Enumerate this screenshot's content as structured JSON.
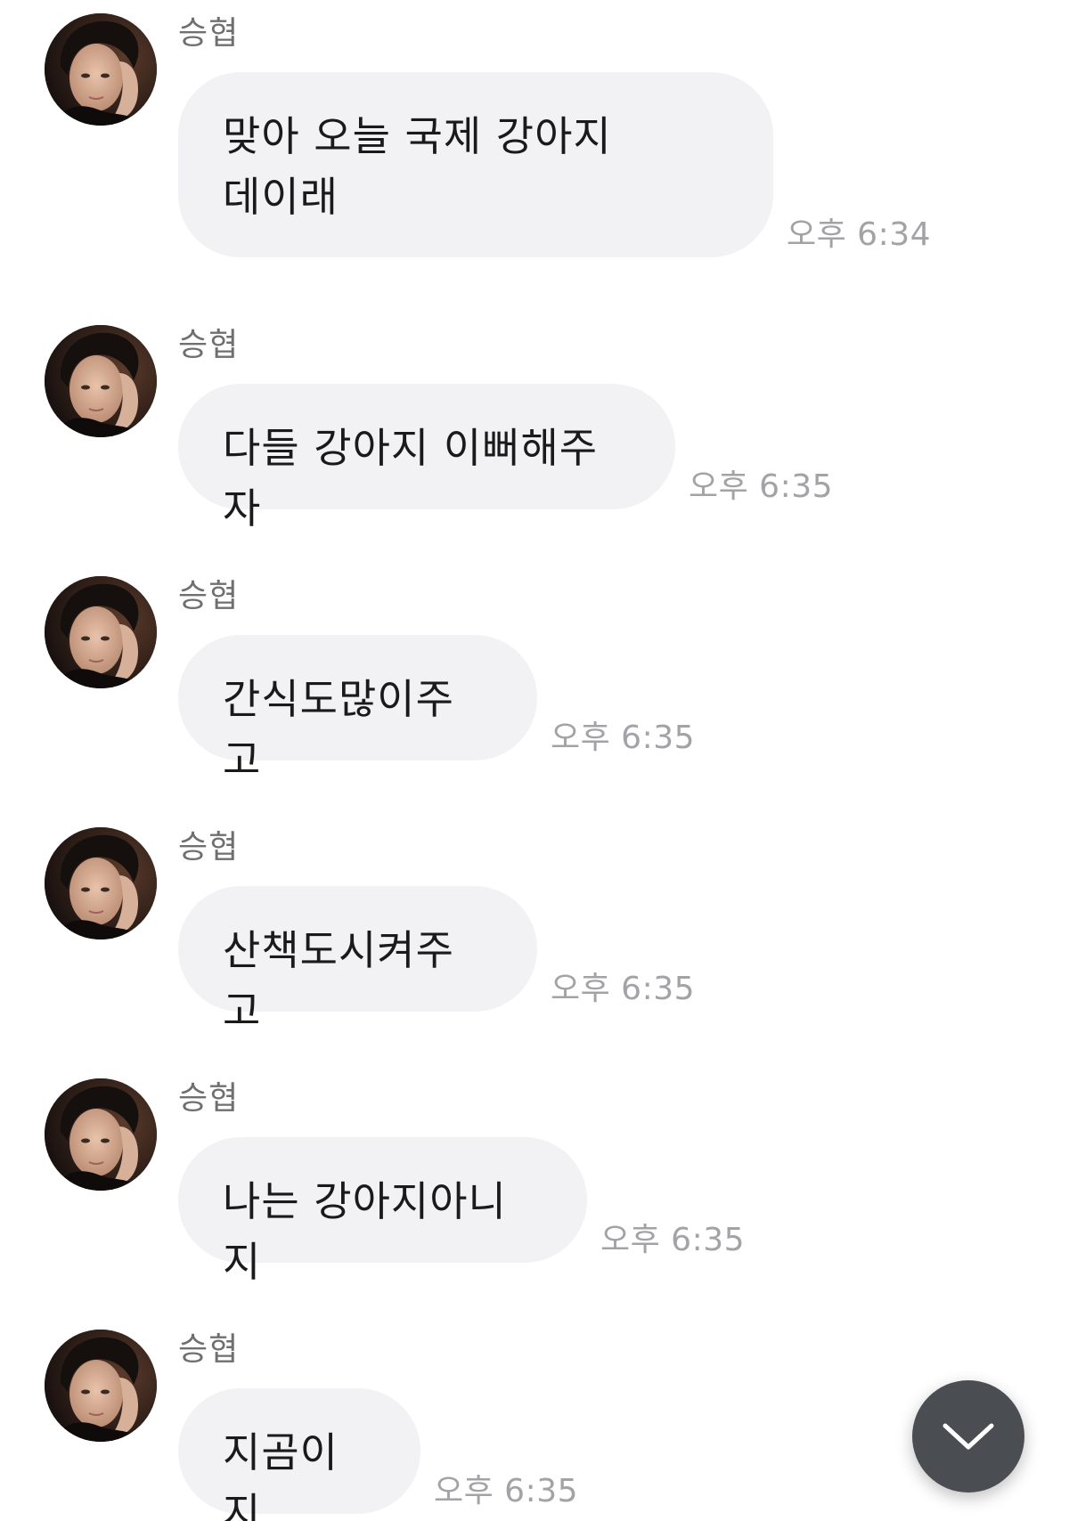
{
  "sender_name": "승협",
  "messages": [
    {
      "text_lines": [
        "맞아 오늘 국제 강아지",
        "데이래"
      ],
      "time": "오후 6:34"
    },
    {
      "text_lines": [
        "다들 강아지 이뻐해주자"
      ],
      "time": "오후 6:35"
    },
    {
      "text_lines": [
        "간식도많이주고"
      ],
      "time": "오후 6:35"
    },
    {
      "text_lines": [
        "산책도시켜주고"
      ],
      "time": "오후 6:35"
    },
    {
      "text_lines": [
        "나는 강아지아니지"
      ],
      "time": "오후 6:35"
    },
    {
      "text_lines": [
        "지곰이지"
      ],
      "time": "오후 6:35"
    }
  ],
  "colors": {
    "bubble_bg": "#f2f2f4",
    "time_text": "#a3a3a7",
    "sender_text": "#6f6f6f",
    "scroll_button_bg": "#4a4d52"
  },
  "scroll_button_icon": "chevron-down-icon"
}
